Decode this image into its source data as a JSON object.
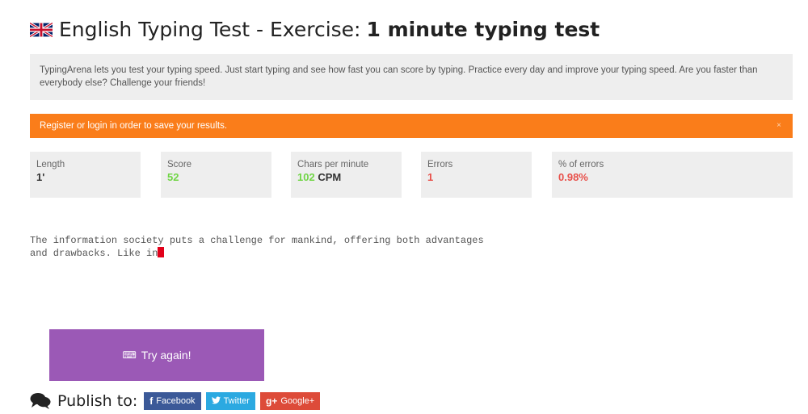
{
  "header": {
    "title_prefix": "English Typing Test - Exercise:",
    "title_bold": "1 minute typing test"
  },
  "intro": {
    "text": "TypingArena lets you test your typing speed. Just start typing and see how fast you can score by typing. Practice every day and improve your typing speed. Are you faster than everybody else? Challenge your friends!"
  },
  "alert": {
    "text": "Register or login in order to save your results.",
    "close": "×",
    "color": "#fa7d1a"
  },
  "stats": {
    "length": {
      "label": "Length",
      "value": "1'"
    },
    "score": {
      "label": "Score",
      "value": "52"
    },
    "cpm": {
      "label": "Chars per minute",
      "value": "102",
      "unit": "CPM"
    },
    "errors": {
      "label": "Errors",
      "value": "1"
    },
    "error_pct": {
      "label": "% of errors",
      "value": "0.98%"
    }
  },
  "typing": {
    "text": "The information society puts a challenge for mankind, offering both advantages\nand drawbacks. Like in"
  },
  "actions": {
    "try_again_icon": "⌨",
    "try_again_label": "Try again!",
    "button_color": "#9b59b6"
  },
  "publish": {
    "label": "Publish to:",
    "icon": "comments-icon",
    "buttons": {
      "facebook": {
        "icon": "f",
        "label": "Facebook",
        "color": "#3b5998"
      },
      "twitter": {
        "icon": "twitter-bird-icon",
        "label": "Twitter",
        "color": "#2ba9e1"
      },
      "google": {
        "icon": "g+",
        "label": "Google+",
        "color": "#dd4b39"
      }
    }
  }
}
